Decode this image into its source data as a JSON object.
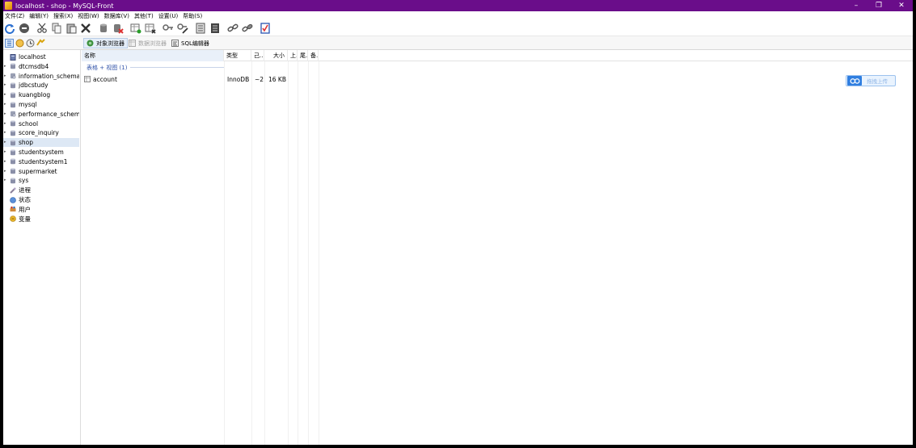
{
  "window": {
    "title": "localhost - shop - MySQL-Front",
    "controls": {
      "minimize": "–",
      "restore": "❐",
      "close": "✕"
    }
  },
  "menu": [
    "文件(Z)",
    "编辑(Y)",
    "搜索(X)",
    "视图(W)",
    "数据库(V)",
    "其他(T)",
    "设置(U)",
    "帮助(S)"
  ],
  "toolbar_icons": [
    "refresh-icon",
    "stop-icon",
    "cut-icon",
    "copy-icon",
    "paste-icon",
    "delete-icon",
    "database-icon",
    "database-delete-icon",
    "table-add-icon",
    "table-delete-icon",
    "key-icon",
    "key-edit-icon",
    "index-icon",
    "index-edit-icon",
    "link-icon",
    "link-edit-icon",
    "checklist-icon"
  ],
  "view_tabs": {
    "object_browser": "对象浏览器",
    "data_browser": "数据浏览器",
    "sql_editor": "SQL编辑器"
  },
  "tree": {
    "root": "localhost",
    "databases": [
      "dtcmsdb4",
      "information_schema",
      "jdbcstudy",
      "kuangblog",
      "mysql",
      "performance_schema",
      "school",
      "score_inquiry",
      "shop",
      "studentsystem",
      "studentsystem1",
      "supermarket",
      "sys"
    ],
    "selected": "shop",
    "extras": [
      "进程",
      "状态",
      "用户",
      "变量"
    ]
  },
  "columns": {
    "name": "名称",
    "type": "类型",
    "rows": "己..",
    "size": "大小",
    "updated": "上.",
    "tail": "尾.",
    "note": "备."
  },
  "group": {
    "label": "表格 + 视图 (1)"
  },
  "rows": [
    {
      "name": "account",
      "type": "InnoDB",
      "rows": "~2",
      "size": "16 KB"
    }
  ],
  "float_button": {
    "label": "拖拽上传"
  },
  "colors": {
    "titlebar": "#6a0d8a",
    "selection": "#dde8f5",
    "accent": "#2f7ee0"
  }
}
